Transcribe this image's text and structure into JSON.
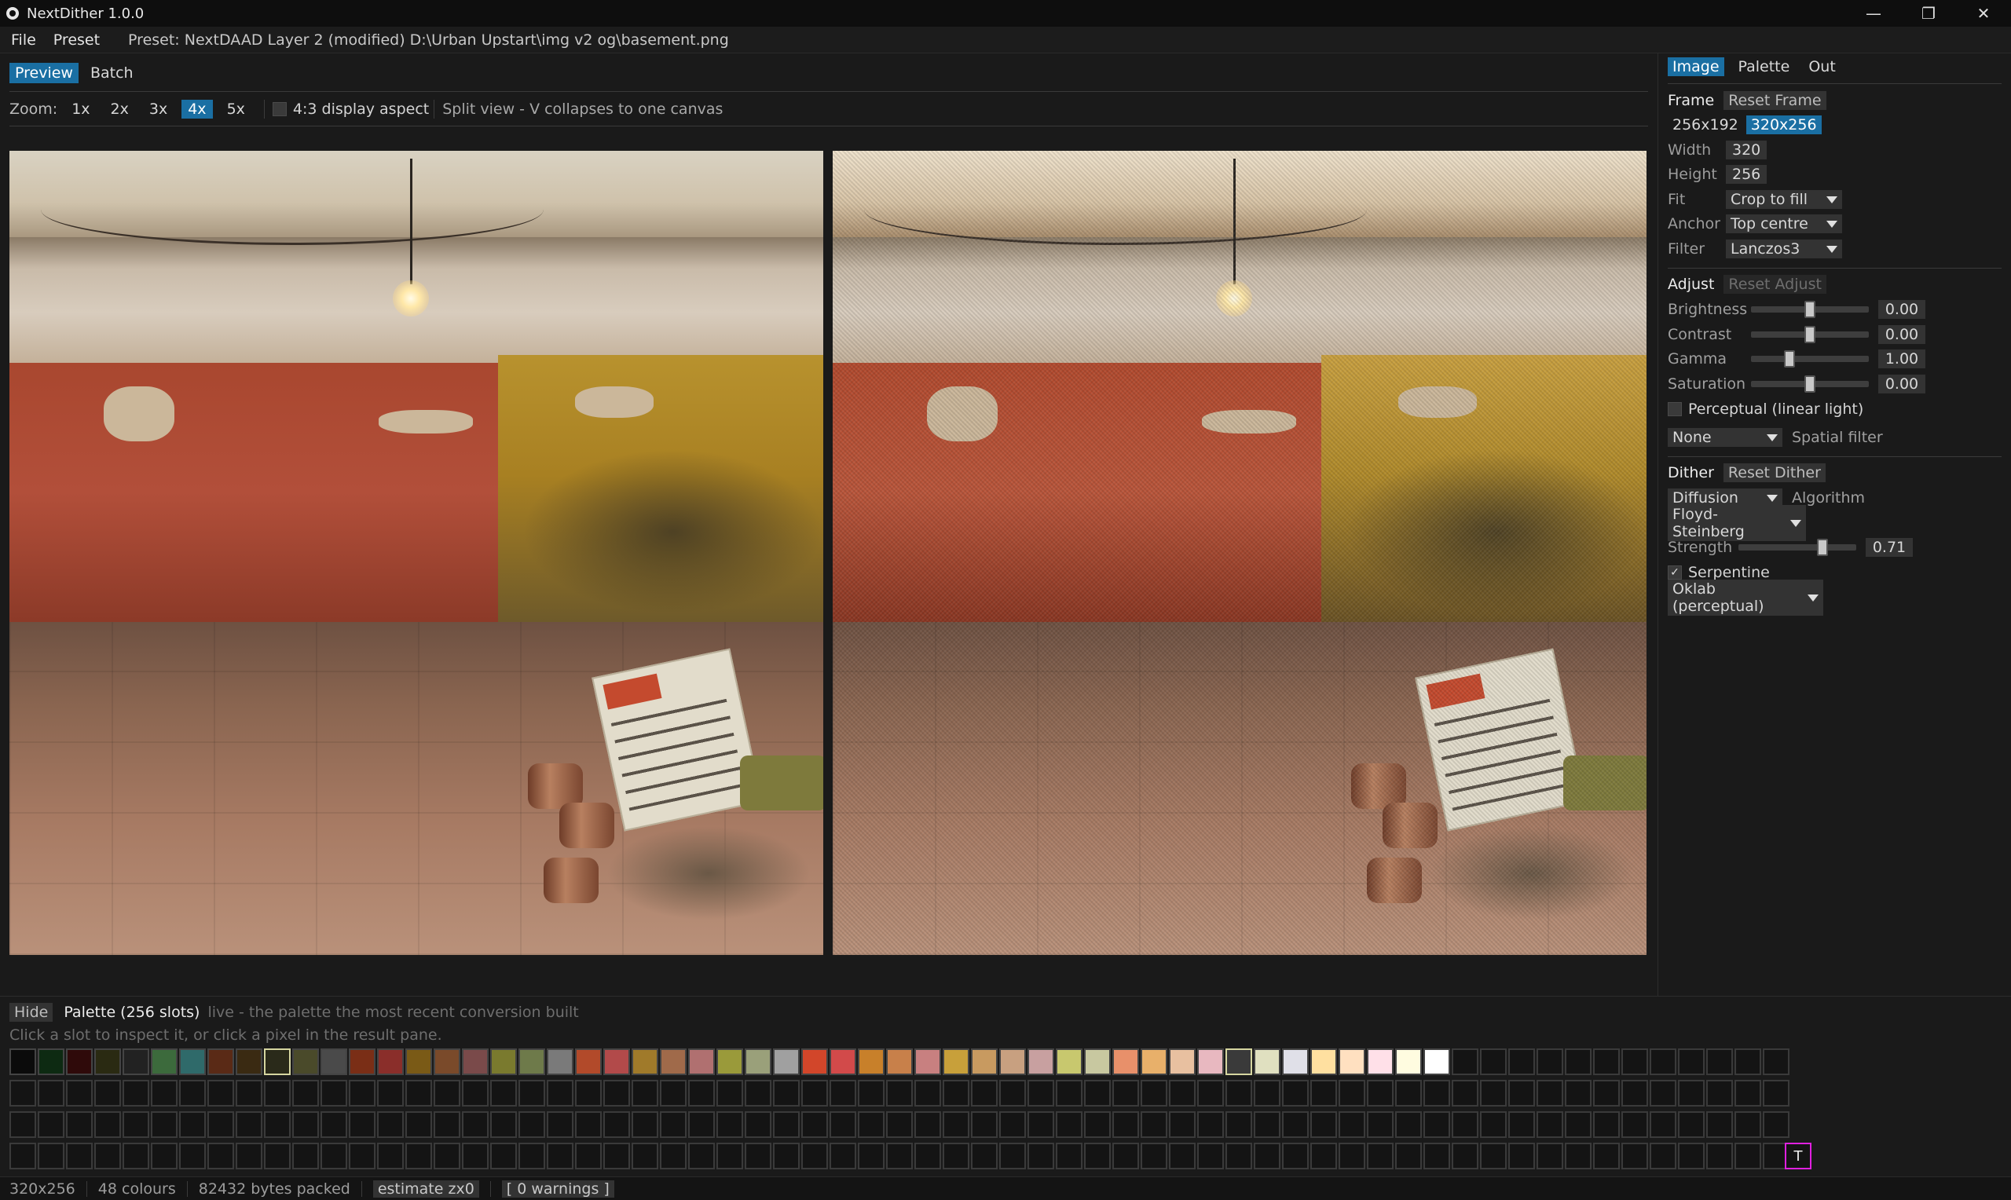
{
  "window": {
    "title": "NextDither 1.0.0",
    "controls": [
      "—",
      "❐",
      "✕"
    ]
  },
  "menu": {
    "file": "File",
    "preset": "Preset",
    "info": "Preset: NextDAAD Layer 2 (modified)  D:\\Urban Upstart\\img v2 og\\basement.png"
  },
  "left": {
    "tabs": [
      "Preview",
      "Batch"
    ],
    "zoom_label": "Zoom:",
    "zoom_levels": [
      "1x",
      "2x",
      "3x",
      "4x",
      "5x"
    ],
    "aspect_label": "4:3 display aspect",
    "split_text": "Split view - V collapses to one canvas"
  },
  "right": {
    "tabs": [
      "Image",
      "Palette",
      "Out"
    ],
    "frame": {
      "heading": "Frame",
      "reset": "Reset Frame",
      "options": [
        "256x192",
        "320x256"
      ],
      "width_label": "Width",
      "width": "320",
      "height_label": "Height",
      "height": "256",
      "fit_label": "Fit",
      "fit": "Crop to fill",
      "anchor_label": "Anchor",
      "anchor": "Top centre",
      "filter_label": "Filter",
      "filter": "Lanczos3"
    },
    "adjust": {
      "heading": "Adjust",
      "reset": "Reset Adjust",
      "brightness_label": "Brightness",
      "brightness": "0.00",
      "contrast_label": "Contrast",
      "contrast": "0.00",
      "gamma_label": "Gamma",
      "gamma": "1.00",
      "saturation_label": "Saturation",
      "saturation": "0.00",
      "perceptual_label": "Perceptual (linear light)",
      "spatial_value": "None",
      "spatial_label": "Spatial filter"
    },
    "dither": {
      "heading": "Dither",
      "reset": "Reset Dither",
      "mode": "Diffusion",
      "algorithm_label": "Algorithm",
      "algorithm": "Floyd-Steinberg",
      "strength_label": "Strength",
      "strength": "0.71",
      "serpentine_label": "Serpentine",
      "colorspace": "Oklab (perceptual)"
    }
  },
  "palette": {
    "hide": "Hide",
    "title": "Palette (256 slots)",
    "subtitle": "live - the palette the most recent conversion built",
    "hint": "Click a slot to inspect it, or click a pixel in the result pane.",
    "cursor_glyph": "T",
    "colors": [
      "#0b0b0b",
      "#0d2a12",
      "#2f0a0a",
      "#2a2a12",
      "#222222",
      "#3c6a3c",
      "#2f6a6a",
      "#5a2a16",
      "#3a2a12",
      "#2a2a1a",
      "#4a4a2a",
      "#4a4a4a",
      "#7a2e16",
      "#8a2e2a",
      "#7a5a16",
      "#7a4a2a",
      "#7a4a4a",
      "#7a7a2e",
      "#6e7a4a",
      "#7a7a7a",
      "#b24a2a",
      "#b24a4a",
      "#a07a2a",
      "#a06a4a",
      "#b07070",
      "#9a9a3a",
      "#9aa07a",
      "#a0a0a0",
      "#d2462a",
      "#d24a4a",
      "#c8802a",
      "#c8804a",
      "#c88080",
      "#c8a03a",
      "#c89a60",
      "#c8a080",
      "#c8a0a0",
      "#c8c86e",
      "#c8c8a0",
      "#e8906a",
      "#e8b06a",
      "#e8c0a0",
      "#e8b8c0",
      "#3a3a3a",
      "#e0e0c0",
      "#e0e0e8",
      "#ffe0a0",
      "#ffe0c0",
      "#ffe0e8",
      "#fffce0",
      "#ffffff"
    ],
    "selected": [
      9,
      43
    ]
  },
  "status": {
    "dims": "320x256",
    "colours": "48 colours",
    "bytes": "82432 bytes packed",
    "estimate": "estimate zx0",
    "warnings": "[ 0 warnings ]"
  },
  "colors": {
    "accent": "#1a6fa3",
    "cursor": "#e020e0"
  }
}
